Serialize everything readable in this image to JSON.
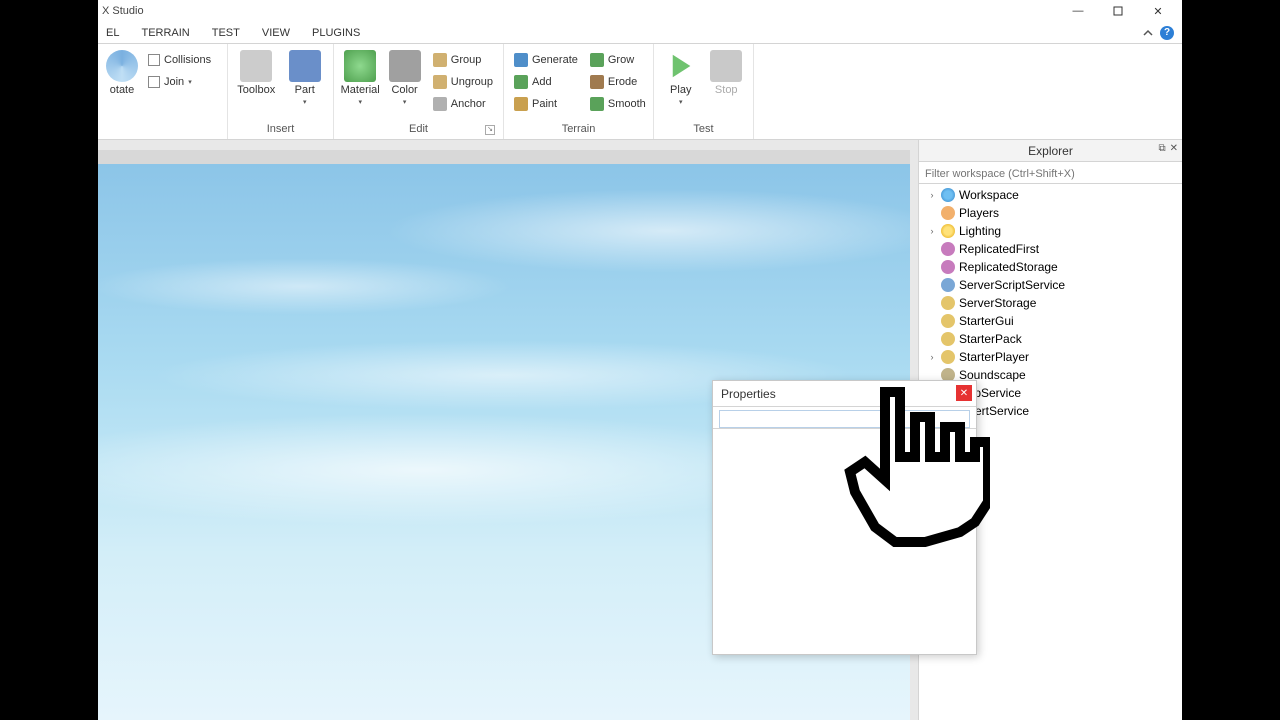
{
  "title": "X Studio",
  "menu": {
    "items": [
      "EL",
      "TERRAIN",
      "TEST",
      "VIEW",
      "PLUGINS"
    ]
  },
  "ribbon": {
    "rotate": "otate",
    "collisions": "Collisions",
    "join": "Join",
    "toolbox": "Toolbox",
    "part": "Part",
    "insert_group": "Insert",
    "material": "Material",
    "color": "Color",
    "group": "Group",
    "ungroup": "Ungroup",
    "anchor": "Anchor",
    "edit_group": "Edit",
    "generate": "Generate",
    "add": "Add",
    "paint": "Paint",
    "grow": "Grow",
    "erode": "Erode",
    "smooth": "Smooth",
    "terrain_group": "Terrain",
    "play": "Play",
    "stop": "Stop",
    "test_group": "Test"
  },
  "explorer": {
    "title": "Explorer",
    "filter_placeholder": "Filter workspace (Ctrl+Shift+X)",
    "nodes": [
      {
        "label": "Workspace",
        "ic": "ic-ws",
        "exp": true
      },
      {
        "label": "Players",
        "ic": "ic-players",
        "exp": false
      },
      {
        "label": "Lighting",
        "ic": "ic-light",
        "exp": true
      },
      {
        "label": "ReplicatedFirst",
        "ic": "ic-store",
        "exp": false
      },
      {
        "label": "ReplicatedStorage",
        "ic": "ic-store",
        "exp": false
      },
      {
        "label": "ServerScriptService",
        "ic": "ic-gear",
        "exp": false
      },
      {
        "label": "ServerStorage",
        "ic": "ic-folder",
        "exp": false
      },
      {
        "label": "StarterGui",
        "ic": "ic-folder",
        "exp": false
      },
      {
        "label": "StarterPack",
        "ic": "ic-folder",
        "exp": false
      },
      {
        "label": "StarterPlayer",
        "ic": "ic-folder",
        "exp": true
      },
      {
        "label": "Soundscape",
        "ic": "ic-sound",
        "exp": false
      },
      {
        "label": "HttpService",
        "ic": "ic-svc",
        "exp": false
      },
      {
        "label": "InsertService",
        "ic": "ic-svc",
        "exp": false
      }
    ]
  },
  "properties": {
    "title": "Properties"
  },
  "colors": {
    "toolbox": "#9aa6b5",
    "part": "#6a8fc9",
    "material": "#6ab96d",
    "color": "#a0a0a0",
    "play": "#6fc36f",
    "stop": "#c9c9c9",
    "generate": "#4f8ec9",
    "add": "#5aa25a",
    "paint": "#c9a04f",
    "grow": "#5aa25a",
    "erode": "#a07a4f",
    "smooth": "#5aa25a"
  }
}
